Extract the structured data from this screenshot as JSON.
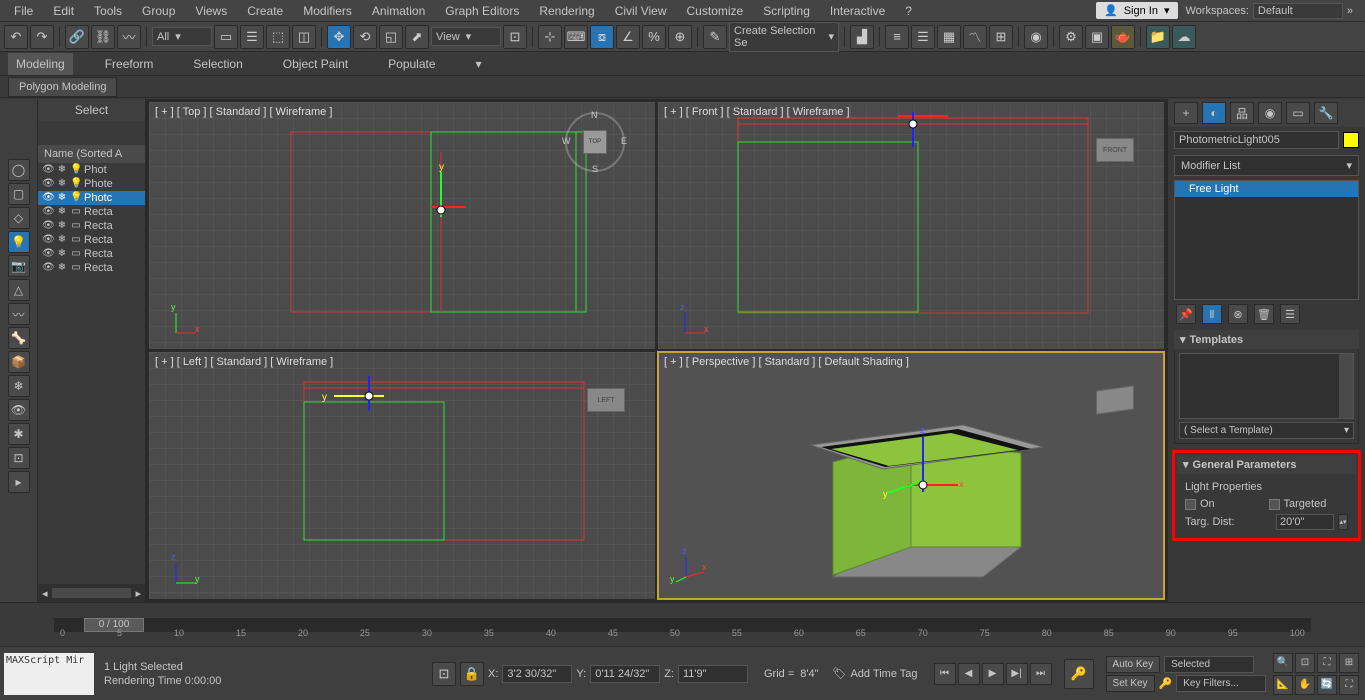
{
  "menubar": {
    "items": [
      "File",
      "Edit",
      "Tools",
      "Group",
      "Views",
      "Create",
      "Modifiers",
      "Animation",
      "Graph Editors",
      "Rendering",
      "Civil View",
      "Customize",
      "Scripting",
      "Interactive"
    ],
    "signin": "Sign In",
    "workspaces_label": "Workspaces:",
    "workspaces_value": "Default"
  },
  "toolbar": {
    "filter": "All",
    "view": "View",
    "selset": "Create Selection Se"
  },
  "ribbon": {
    "tabs": [
      "Modeling",
      "Freeform",
      "Selection",
      "Object Paint",
      "Populate"
    ],
    "sub": "Polygon Modeling"
  },
  "scene": {
    "title": "Select",
    "header": "Name (Sorted A",
    "items": [
      "Phot",
      "Phote",
      "Photc",
      "Recta",
      "Recta",
      "Recta",
      "Recta",
      "Recta"
    ],
    "selected": 2
  },
  "viewports": {
    "tl": "[ + ] [ Top ] [ Standard ] [ Wireframe ]",
    "tr": "[ + ] [ Front ] [ Standard ] [ Wireframe ]",
    "bl": "[ + ] [ Left ] [ Standard ] [ Wireframe ]",
    "br": "[ + ] [ Perspective ] [ Standard ] [ Default Shading ]",
    "cube_face": "TOP",
    "cube_tr": "FRONT",
    "cube_bl": "LEFT"
  },
  "rightpanel": {
    "object_name": "PhotometricLight005",
    "modifier_list": "Modifier List",
    "stack_item": "Free Light",
    "templates_title": "Templates",
    "templates_select": "( Select a Template)",
    "gp_title": "General Parameters",
    "gp_section": "Light Properties",
    "gp_on": "On",
    "gp_targeted": "Targeted",
    "gp_targdist_label": "Targ. Dist:",
    "gp_targdist_value": "20'0\""
  },
  "timeline": {
    "pos": "0 / 100",
    "ticks": [
      "0",
      "5",
      "10",
      "15",
      "20",
      "25",
      "30",
      "35",
      "40",
      "45",
      "50",
      "55",
      "60",
      "65",
      "70",
      "75",
      "80",
      "85",
      "90",
      "95",
      "100"
    ]
  },
  "statusbar": {
    "script": "MAXScript Mir",
    "selection": "1 Light Selected",
    "rendering": "Rendering Time  0:00:00",
    "x_label": "X:",
    "x": "3'2 30/32\"",
    "y_label": "Y:",
    "y": "0'11 24/32\"",
    "z_label": "Z:",
    "z": "11'9\"",
    "grid_label": "Grid = ",
    "grid": "8'4\"",
    "addtime": "Add Time Tag",
    "autokey": "Auto Key",
    "setkey": "Set Key",
    "selected": "Selected",
    "keyfilters": "Key Filters..."
  }
}
